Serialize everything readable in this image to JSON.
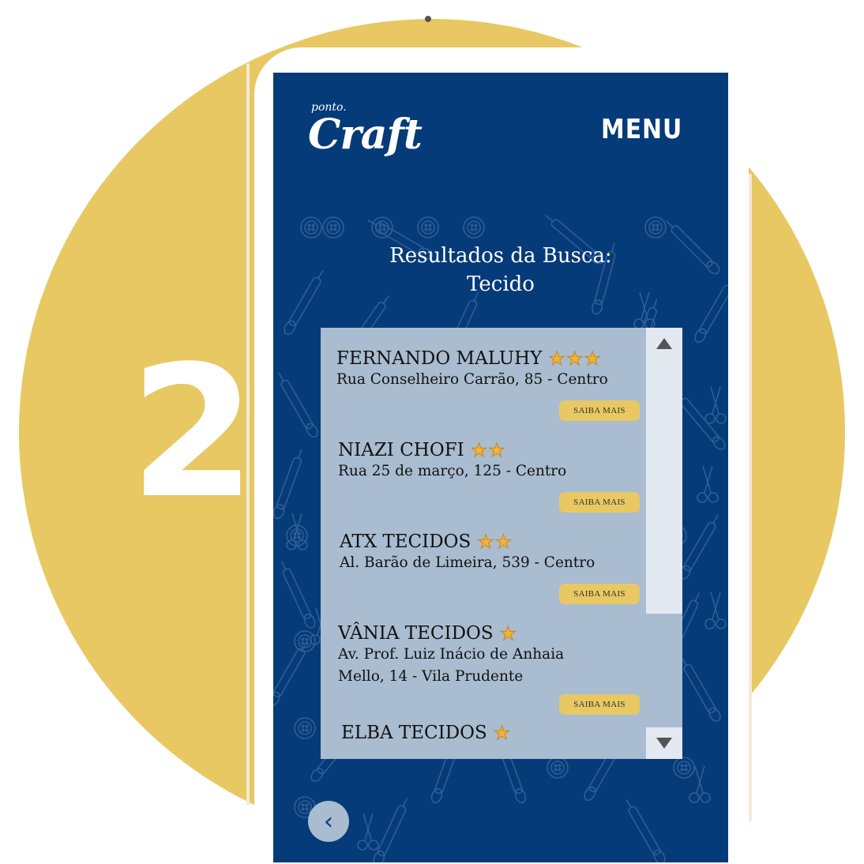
{
  "step": {
    "number": "2"
  },
  "app": {
    "logo_small": "ponto.",
    "logo_big": "Craft",
    "menu_label": "MENU"
  },
  "results": {
    "title_line1": "Resultados da Busca:",
    "title_line2": "Tecido"
  },
  "items": [
    {
      "name": "FERNANDO MALUHY",
      "stars": 3,
      "address_line1": "Rua Conselheiro Carrão, 85 - Centro",
      "address_line2": "",
      "button": "SAIBA MAIS"
    },
    {
      "name": "NIAZI CHOFI",
      "stars": 2,
      "address_line1": "Rua 25 de março, 125 - Centro",
      "address_line2": "",
      "button": "SAIBA MAIS"
    },
    {
      "name": "ATX TECIDOS",
      "stars": 2,
      "address_line1": "Al. Barão de Limeira, 539 - Centro",
      "address_line2": "",
      "button": "SAIBA MAIS"
    },
    {
      "name": "VÂNIA TECIDOS",
      "stars": 1,
      "address_line1": "Av. Prof. Luiz Inácio de Anhaia",
      "address_line2": "Mello, 14 - Vila Prudente",
      "button": "SAIBA MAIS"
    },
    {
      "name": "ELBA TECIDOS",
      "stars": 1,
      "address_line1": "",
      "address_line2": "",
      "button": ""
    }
  ],
  "icons": {
    "scroll_up": "triangle-up-icon",
    "scroll_down": "triangle-down-icon",
    "back": "chevron-left-icon",
    "star": "star-icon"
  },
  "colors": {
    "circle": "#e8c862",
    "screen": "#053b78",
    "panel": "#a9bcd0",
    "button": "#e8c862",
    "star": "#f3b23a"
  }
}
